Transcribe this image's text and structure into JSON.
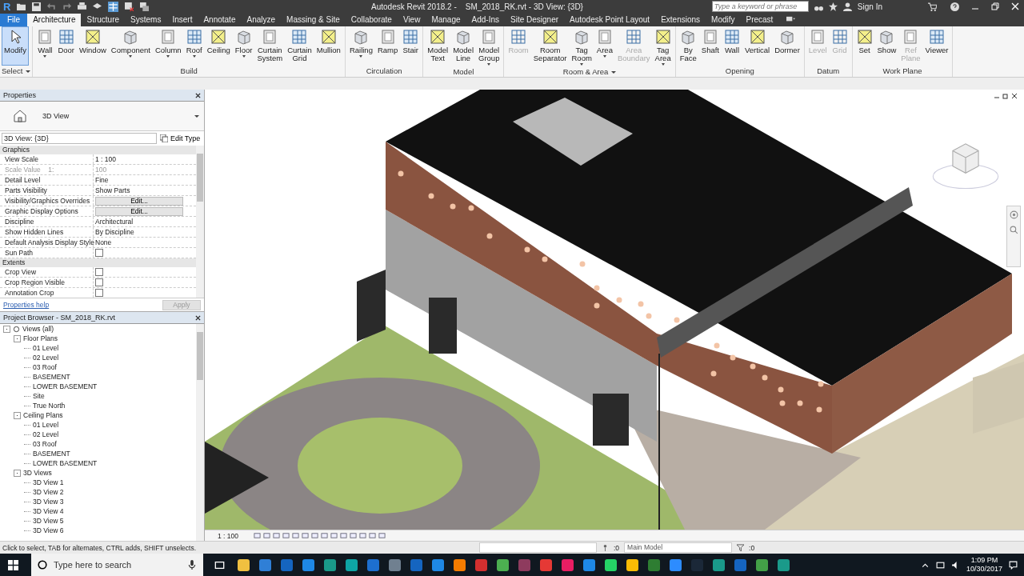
{
  "quick_access": {
    "logo": "R"
  },
  "window": {
    "title": "Autodesk Revit 2018.2 -    SM_2018_RK.rvt - 3D View: {3D}"
  },
  "search": {
    "placeholder": "Type a keyword or phrase"
  },
  "sign_in": "Sign In",
  "file_tab": "File",
  "tabs": [
    {
      "label": "Architecture",
      "selected": true
    },
    {
      "label": "Structure",
      "selected": false
    },
    {
      "label": "Systems",
      "selected": false
    },
    {
      "label": "Insert",
      "selected": false
    },
    {
      "label": "Annotate",
      "selected": false
    },
    {
      "label": "Analyze",
      "selected": false
    },
    {
      "label": "Massing & Site",
      "selected": false
    },
    {
      "label": "Collaborate",
      "selected": false
    },
    {
      "label": "View",
      "selected": false
    },
    {
      "label": "Manage",
      "selected": false
    },
    {
      "label": "Add-Ins",
      "selected": false
    },
    {
      "label": "Site Designer",
      "selected": false
    },
    {
      "label": "Autodesk Point Layout",
      "selected": false
    },
    {
      "label": "Extensions",
      "selected": false
    },
    {
      "label": "Modify",
      "selected": false
    },
    {
      "label": "Precast",
      "selected": false
    }
  ],
  "ribbon": [
    {
      "label": "Select",
      "dropdown": true,
      "tools": [
        {
          "label": "Modify",
          "selected": true,
          "disabled": false,
          "dropdown": false
        }
      ]
    },
    {
      "label": "Build",
      "dropdown": false,
      "tools": [
        {
          "label": "Wall",
          "selected": false,
          "disabled": false,
          "dropdown": true
        },
        {
          "label": "Door",
          "selected": false,
          "disabled": false,
          "dropdown": false
        },
        {
          "label": "Window",
          "selected": false,
          "disabled": false,
          "dropdown": false
        },
        {
          "label": "Component",
          "selected": false,
          "disabled": false,
          "dropdown": true
        },
        {
          "label": "Column",
          "selected": false,
          "disabled": false,
          "dropdown": true
        },
        {
          "label": "Roof",
          "selected": false,
          "disabled": false,
          "dropdown": true
        },
        {
          "label": "Ceiling",
          "selected": false,
          "disabled": false,
          "dropdown": false
        },
        {
          "label": "Floor",
          "selected": false,
          "disabled": false,
          "dropdown": true
        },
        {
          "label": "Curtain\nSystem",
          "selected": false,
          "disabled": false,
          "dropdown": false
        },
        {
          "label": "Curtain\nGrid",
          "selected": false,
          "disabled": false,
          "dropdown": false
        },
        {
          "label": "Mullion",
          "selected": false,
          "disabled": false,
          "dropdown": false
        }
      ]
    },
    {
      "label": "Circulation",
      "dropdown": false,
      "tools": [
        {
          "label": "Railing",
          "selected": false,
          "disabled": false,
          "dropdown": true
        },
        {
          "label": "Ramp",
          "selected": false,
          "disabled": false,
          "dropdown": false
        },
        {
          "label": "Stair",
          "selected": false,
          "disabled": false,
          "dropdown": false
        }
      ]
    },
    {
      "label": "Model",
      "dropdown": false,
      "tools": [
        {
          "label": "Model\nText",
          "selected": false,
          "disabled": false,
          "dropdown": false
        },
        {
          "label": "Model\nLine",
          "selected": false,
          "disabled": false,
          "dropdown": false
        },
        {
          "label": "Model\nGroup",
          "selected": false,
          "disabled": false,
          "dropdown": true
        }
      ]
    },
    {
      "label": "Room & Area",
      "dropdown": true,
      "tools": [
        {
          "label": "Room",
          "selected": false,
          "disabled": true,
          "dropdown": false
        },
        {
          "label": "Room\nSeparator",
          "selected": false,
          "disabled": false,
          "dropdown": false
        },
        {
          "label": "Tag\nRoom",
          "selected": false,
          "disabled": false,
          "dropdown": true
        },
        {
          "label": "Area",
          "selected": false,
          "disabled": false,
          "dropdown": true
        },
        {
          "label": "Area\nBoundary",
          "selected": false,
          "disabled": true,
          "dropdown": false
        },
        {
          "label": "Tag\nArea",
          "selected": false,
          "disabled": false,
          "dropdown": true
        }
      ]
    },
    {
      "label": "Opening",
      "dropdown": false,
      "tools": [
        {
          "label": "By\nFace",
          "selected": false,
          "disabled": false,
          "dropdown": false
        },
        {
          "label": "Shaft",
          "selected": false,
          "disabled": false,
          "dropdown": false
        },
        {
          "label": "Wall",
          "selected": false,
          "disabled": false,
          "dropdown": false
        },
        {
          "label": "Vertical",
          "selected": false,
          "disabled": false,
          "dropdown": false
        },
        {
          "label": "Dormer",
          "selected": false,
          "disabled": false,
          "dropdown": false
        }
      ]
    },
    {
      "label": "Datum",
      "dropdown": false,
      "tools": [
        {
          "label": "Level",
          "selected": false,
          "disabled": true,
          "dropdown": false
        },
        {
          "label": "Grid",
          "selected": false,
          "disabled": true,
          "dropdown": false
        }
      ]
    },
    {
      "label": "Work Plane",
      "dropdown": false,
      "tools": [
        {
          "label": "Set",
          "selected": false,
          "disabled": false,
          "dropdown": false
        },
        {
          "label": "Show",
          "selected": false,
          "disabled": false,
          "dropdown": false
        },
        {
          "label": "Ref\nPlane",
          "selected": false,
          "disabled": true,
          "dropdown": false
        },
        {
          "label": "Viewer",
          "selected": false,
          "disabled": false,
          "dropdown": false
        }
      ]
    }
  ],
  "properties": {
    "title": "Properties",
    "type_name": "3D View",
    "instance": "3D View: {3D}",
    "edit_type": "Edit Type",
    "groups": [
      {
        "name": "Graphics",
        "rows": [
          {
            "label": "View Scale",
            "value": "1 : 100",
            "kind": "text",
            "disabled": false
          },
          {
            "label": "Scale Value    1:",
            "value": "100",
            "kind": "text",
            "disabled": true
          },
          {
            "label": "Detail Level",
            "value": "Fine",
            "kind": "text",
            "disabled": false
          },
          {
            "label": "Parts Visibility",
            "value": "Show Parts",
            "kind": "text",
            "disabled": false
          },
          {
            "label": "Visibility/Graphics Overrides",
            "value": "Edit...",
            "kind": "button",
            "disabled": false
          },
          {
            "label": "Graphic Display Options",
            "value": "Edit...",
            "kind": "button",
            "disabled": false
          },
          {
            "label": "Discipline",
            "value": "Architectural",
            "kind": "text",
            "disabled": false
          },
          {
            "label": "Show Hidden Lines",
            "value": "By Discipline",
            "kind": "text",
            "disabled": false
          },
          {
            "label": "Default Analysis Display Style",
            "value": "None",
            "kind": "text",
            "disabled": false
          },
          {
            "label": "Sun Path",
            "kind": "checkbox",
            "checked": false,
            "disabled": false
          }
        ]
      },
      {
        "name": "Extents",
        "rows": [
          {
            "label": "Crop View",
            "kind": "checkbox",
            "checked": false,
            "disabled": false
          },
          {
            "label": "Crop Region Visible",
            "kind": "checkbox",
            "checked": false,
            "disabled": false
          },
          {
            "label": "Annotation Crop",
            "kind": "checkbox",
            "checked": false,
            "disabled": false
          }
        ]
      }
    ],
    "help": "Properties help",
    "apply": "Apply"
  },
  "project_browser": {
    "title": "Project Browser - SM_2018_RK.rvt",
    "tree": [
      {
        "label": "Views (all)",
        "expanded": true,
        "children": [
          {
            "label": "Floor Plans",
            "expanded": true,
            "children": [
              {
                "label": "01 Level"
              },
              {
                "label": "02 Level"
              },
              {
                "label": "03 Roof"
              },
              {
                "label": "BASEMENT"
              },
              {
                "label": "LOWER BASEMENT"
              },
              {
                "label": "Site"
              },
              {
                "label": "True North"
              }
            ]
          },
          {
            "label": "Ceiling Plans",
            "expanded": true,
            "children": [
              {
                "label": "01 Level"
              },
              {
                "label": "02 Level"
              },
              {
                "label": "03 Roof"
              },
              {
                "label": "BASEMENT"
              },
              {
                "label": "LOWER BASEMENT"
              }
            ]
          },
          {
            "label": "3D Views",
            "expanded": true,
            "children": [
              {
                "label": "3D View 1"
              },
              {
                "label": "3D View 2"
              },
              {
                "label": "3D View 3"
              },
              {
                "label": "3D View 4"
              },
              {
                "label": "3D View 5"
              },
              {
                "label": "3D View 6"
              }
            ]
          }
        ]
      }
    ]
  },
  "view_bar": {
    "scale": "1 : 100"
  },
  "status_bar": {
    "message": "Click to select, TAB for alternates, CTRL adds, SHIFT unselects.",
    "count": ":0",
    "model": "Main Model",
    "filter_count": ":0"
  },
  "taskbar": {
    "search_placeholder": "Type here to search",
    "time": "1:09 PM",
    "date": "10/30/2017",
    "apps": [
      {
        "color": "#f0c040"
      },
      {
        "color": "#2f7fd6"
      },
      {
        "color": "#1565c0"
      },
      {
        "color": "#1e88e5"
      },
      {
        "color": "#1a9a8a"
      },
      {
        "color": "#0ea5a5"
      },
      {
        "color": "#1d6fd0"
      },
      {
        "color": "#708090"
      },
      {
        "color": "#1565c0"
      },
      {
        "color": "#1e88e5"
      },
      {
        "color": "#f57c00"
      },
      {
        "color": "#d32f2f"
      },
      {
        "color": "#4caf50"
      },
      {
        "color": "#8e3b5e"
      },
      {
        "color": "#e53935"
      },
      {
        "color": "#e91e63"
      },
      {
        "color": "#1e88e5"
      },
      {
        "color": "#25d366"
      },
      {
        "color": "#fbbc05"
      },
      {
        "color": "#2e7d32"
      },
      {
        "color": "#2d8cff"
      },
      {
        "color": "#1b2838"
      },
      {
        "color": "#1a9a8a"
      },
      {
        "color": "#1565c0"
      },
      {
        "color": "#43a047"
      },
      {
        "color": "#1a9a8a"
      }
    ]
  }
}
